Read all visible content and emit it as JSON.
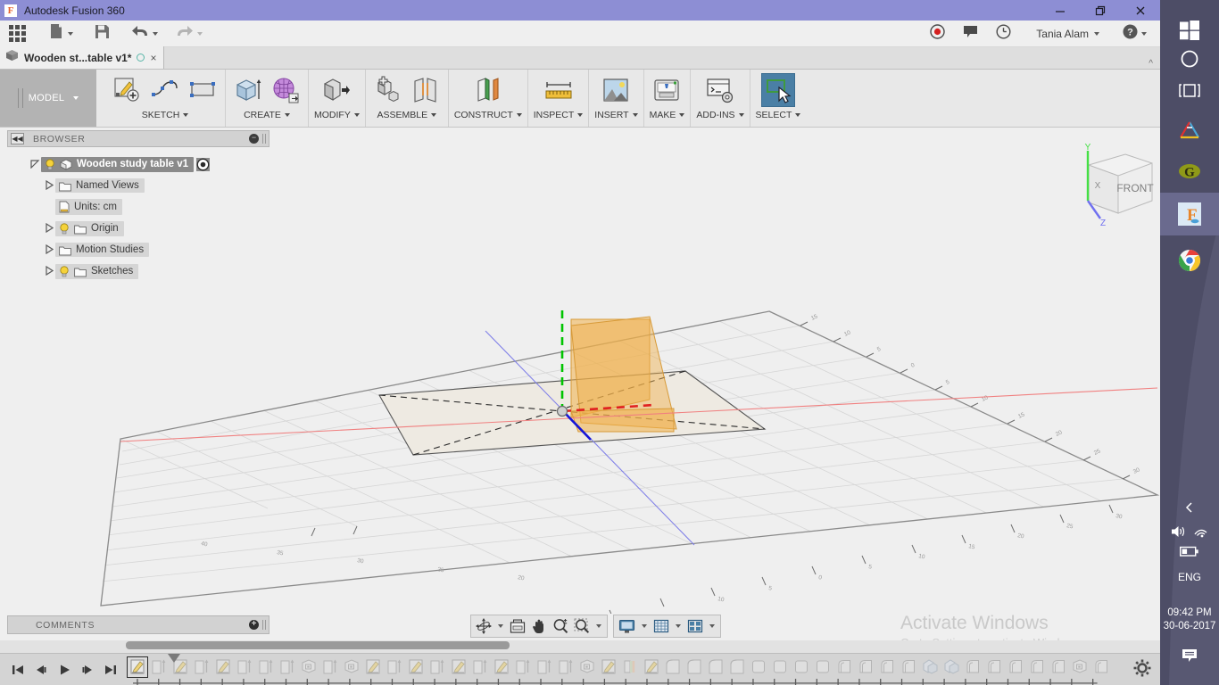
{
  "window": {
    "app_title": "Autodesk Fusion 360",
    "logo_letter": "F",
    "minimize": "minimize-button",
    "restore": "restore-button",
    "close": "close-button"
  },
  "quick_access": {
    "items": [
      {
        "icon": "app-grid-icon",
        "label": "Show Data Panel",
        "caret": false
      },
      {
        "icon": "file-new-icon",
        "label": "File",
        "caret": true
      },
      {
        "icon": "save-icon",
        "label": "Save",
        "caret": false
      },
      {
        "icon": "undo-icon",
        "label": "Undo",
        "caret": true
      },
      {
        "icon": "redo-icon",
        "label": "Redo",
        "caret": true
      }
    ],
    "right_items": [
      {
        "icon": "record-icon",
        "label": "Screencast Recording"
      },
      {
        "icon": "comment-icon",
        "label": "Comments"
      },
      {
        "icon": "clock-icon",
        "label": "Job Status"
      }
    ],
    "user_name": "Tania Alam",
    "help_label": "Help"
  },
  "tabs": {
    "document_tab": {
      "icon": "cube-icon",
      "title": "Wooden st...table v1*",
      "unsaved_dot": "sync-dot",
      "close": "×"
    },
    "strip_caret": "^"
  },
  "ribbon": {
    "workspace": {
      "label": "MODEL",
      "caret": "▾"
    },
    "groups": [
      {
        "name": "SKETCH",
        "label": "SKETCH",
        "caret": "▾",
        "icons": [
          "create-sketch-icon",
          "sketch-spline-icon",
          "sketch-rectangle-icon"
        ]
      },
      {
        "name": "CREATE",
        "label": "CREATE",
        "caret": "▾",
        "icons": [
          "extrude-icon",
          "create-form-icon"
        ]
      },
      {
        "name": "MODIFY",
        "label": "MODIFY",
        "caret": "▾",
        "icons": [
          "press-pull-icon"
        ]
      },
      {
        "name": "ASSEMBLE",
        "label": "ASSEMBLE",
        "caret": "▾",
        "icons": [
          "new-component-icon",
          "joint-icon"
        ]
      },
      {
        "name": "CONSTRUCT",
        "label": "CONSTRUCT",
        "caret": "▾",
        "icons": [
          "offset-plane-icon"
        ]
      },
      {
        "name": "INSPECT",
        "label": "INSPECT",
        "caret": "▾",
        "icons": [
          "measure-icon"
        ]
      },
      {
        "name": "INSERT",
        "label": "INSERT",
        "caret": "▾",
        "icons": [
          "insert-image-icon"
        ]
      },
      {
        "name": "MAKE",
        "label": "MAKE",
        "caret": "▾",
        "icons": [
          "3d-print-icon"
        ]
      },
      {
        "name": "ADD-INS",
        "label": "ADD-INS",
        "caret": "▾",
        "icons": [
          "scripts-addins-icon"
        ]
      },
      {
        "name": "SELECT",
        "label": "SELECT",
        "caret": "▾",
        "icons": [
          "select-cursor-icon"
        ],
        "selected": true
      }
    ]
  },
  "browser": {
    "header": {
      "title": "BROWSER",
      "collapse_icon": "collapse-left-icon",
      "minus_icon": "minimize-panel-icon"
    },
    "tree": [
      {
        "label": "Wooden study table v1",
        "level": 0,
        "arrow": "expanded",
        "bulb": true,
        "icon": "component-cube-icon",
        "selected": true,
        "trailing": "activate-target-icon"
      },
      {
        "label": "Named Views",
        "level": 1,
        "arrow": "collapsed",
        "bulb": false,
        "icon": "folder-icon"
      },
      {
        "label": "Units: cm",
        "level": 1,
        "arrow": "none",
        "bulb": false,
        "icon": "units-doc-icon"
      },
      {
        "label": "Origin",
        "level": 1,
        "arrow": "collapsed",
        "bulb": true,
        "icon": "folder-icon"
      },
      {
        "label": "Motion Studies",
        "level": 1,
        "arrow": "collapsed",
        "bulb": false,
        "icon": "folder-icon"
      },
      {
        "label": "Sketches",
        "level": 1,
        "arrow": "collapsed",
        "bulb": true,
        "icon": "folder-icon"
      }
    ]
  },
  "viewcube": {
    "face_label": "FRONT",
    "axis_x": "X",
    "axis_y": "Y",
    "axis_z": "Z"
  },
  "canvas": {
    "background": "#efefef",
    "grid_color": "#d9d9d9",
    "x_axis_color": "#e03030",
    "y_axis_color": "#00c000",
    "z_axis_color": "#2020d0",
    "sketch_fill": "#f0b04a",
    "plane_fill": "#eeeae2"
  },
  "navbar": {
    "groups": [
      {
        "buttons": [
          {
            "icon": "orbit-icon",
            "label": "Orbit",
            "caret": true
          },
          {
            "icon": "fit-icon",
            "label": "Fit",
            "caret": false
          },
          {
            "icon": "pan-icon",
            "label": "Pan",
            "caret": false
          },
          {
            "icon": "zoom-icon",
            "label": "Zoom",
            "caret": false
          },
          {
            "icon": "zoom-window-icon",
            "label": "Zoom Window",
            "caret": true
          }
        ]
      },
      {
        "buttons": [
          {
            "icon": "display-settings-icon",
            "label": "Display Settings",
            "caret": true
          },
          {
            "icon": "grid-snaps-icon",
            "label": "Grid and Snaps",
            "caret": true
          },
          {
            "icon": "viewports-icon",
            "label": "Viewports",
            "caret": true
          }
        ]
      }
    ]
  },
  "comments": {
    "title": "COMMENTS",
    "add_icon": "add-comment-icon"
  },
  "timeline": {
    "playback": [
      {
        "icon": "skip-to-start-icon",
        "label": "Go to beginning"
      },
      {
        "icon": "step-back-icon",
        "label": "Step back"
      },
      {
        "icon": "play-icon",
        "label": "Play"
      },
      {
        "icon": "step-forward-icon",
        "label": "Step forward"
      },
      {
        "icon": "skip-to-end-icon",
        "label": "Go to end"
      }
    ],
    "features": [
      {
        "icon": "sketch-feature-icon",
        "active": true
      },
      {
        "icon": "extrude-feature-icon",
        "active": false
      },
      {
        "icon": "sketch-feature-icon",
        "active": false
      },
      {
        "icon": "extrude-feature-icon",
        "active": false
      },
      {
        "icon": "sketch-feature-icon",
        "active": false
      },
      {
        "icon": "extrude-feature-icon",
        "active": false
      },
      {
        "icon": "extrude-feature-icon",
        "active": false
      },
      {
        "icon": "extrude-feature-icon",
        "active": false
      },
      {
        "icon": "component-feature-icon",
        "active": false
      },
      {
        "icon": "extrude-feature-icon",
        "active": false
      },
      {
        "icon": "component-feature-icon",
        "active": false
      },
      {
        "icon": "sketch-feature-icon",
        "active": false
      },
      {
        "icon": "extrude-feature-icon",
        "active": false
      },
      {
        "icon": "sketch-feature-icon",
        "active": false
      },
      {
        "icon": "extrude-feature-icon",
        "active": false
      },
      {
        "icon": "sketch-feature-icon",
        "active": false
      },
      {
        "icon": "extrude-feature-icon",
        "active": false
      },
      {
        "icon": "sketch-feature-icon",
        "active": false
      },
      {
        "icon": "extrude-feature-icon",
        "active": false
      },
      {
        "icon": "extrude-feature-icon",
        "active": false
      },
      {
        "icon": "extrude-feature-icon",
        "active": false
      },
      {
        "icon": "component-feature-icon",
        "active": false
      },
      {
        "icon": "sketch-feature-icon",
        "active": false
      },
      {
        "icon": "appearance-feature-icon",
        "active": false
      },
      {
        "icon": "sketch-feature-icon",
        "active": false
      },
      {
        "icon": "fillet-feature-icon",
        "active": false
      },
      {
        "icon": "fillet-feature-icon",
        "active": false
      },
      {
        "icon": "fillet-feature-icon",
        "active": false
      },
      {
        "icon": "fillet-feature-icon",
        "active": false
      },
      {
        "icon": "box-feature-icon",
        "active": false
      },
      {
        "icon": "box-feature-icon",
        "active": false
      },
      {
        "icon": "box-feature-icon",
        "active": false
      },
      {
        "icon": "box-feature-icon",
        "active": false
      },
      {
        "icon": "shell-feature-icon",
        "active": false
      },
      {
        "icon": "shell-feature-icon",
        "active": false
      },
      {
        "icon": "shell-feature-icon",
        "active": false
      },
      {
        "icon": "shell-feature-icon",
        "active": false
      },
      {
        "icon": "move-feature-icon",
        "active": false
      },
      {
        "icon": "move-feature-icon",
        "active": false
      },
      {
        "icon": "shell-feature-icon",
        "active": false
      },
      {
        "icon": "shell-feature-icon",
        "active": false
      },
      {
        "icon": "shell-feature-icon",
        "active": false
      },
      {
        "icon": "shell-feature-icon",
        "active": false
      },
      {
        "icon": "shell-feature-icon",
        "active": false
      },
      {
        "icon": "component-feature-icon",
        "active": false
      },
      {
        "icon": "shell-feature-icon",
        "active": false
      }
    ],
    "settings_icon": "timeline-settings-icon"
  },
  "watermark": {
    "line1": "Activate Windows",
    "line2": "Go to Settings to activate Windows."
  },
  "taskbar": {
    "items": [
      {
        "icon": "windows-start-icon",
        "label": "Start",
        "active": false
      },
      {
        "icon": "cortana-circle-icon",
        "label": "Cortana",
        "active": false
      },
      {
        "icon": "task-view-icon",
        "label": "Task View",
        "active": false
      },
      {
        "icon": "autodesk-icon",
        "label": "Autodesk",
        "active": false
      },
      {
        "icon": "g-app-icon",
        "label": "G App",
        "active": false
      },
      {
        "icon": "fusion360-icon",
        "label": "Autodesk Fusion 360",
        "active": true
      },
      {
        "icon": "chrome-icon",
        "label": "Google Chrome",
        "active": false
      }
    ],
    "tray": {
      "chevron": "show-hidden-icons-icon",
      "volume": "volume-icon",
      "wifi": "wifi-icon",
      "battery": "battery-icon",
      "language": "ENG",
      "time": "09:42 PM",
      "date": "30-06-2017",
      "action_center": "action-center-icon"
    }
  }
}
